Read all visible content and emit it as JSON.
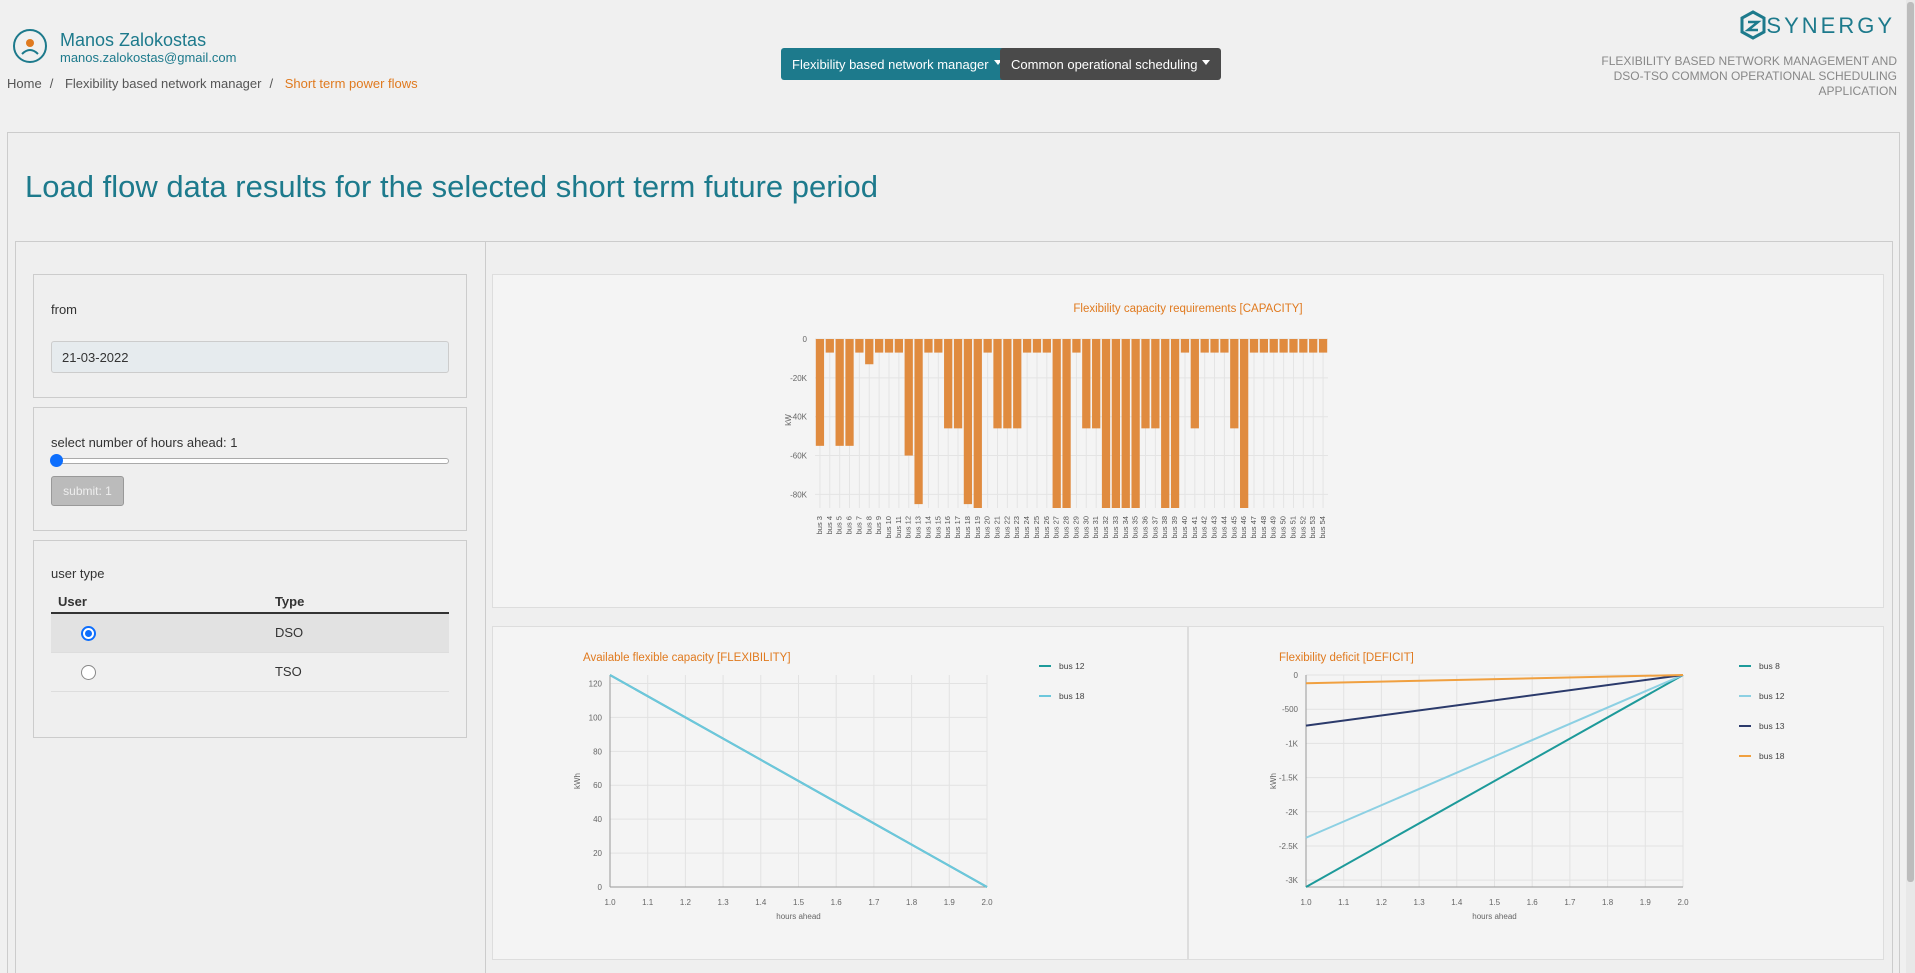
{
  "user": {
    "name": "Manos Zalokostas",
    "email": "manos.zalokostas@gmail.com"
  },
  "breadcrumb": [
    "Home",
    "Flexibility based network manager",
    "Short term power flows"
  ],
  "nav": {
    "flex_manager": "Flexibility based network manager",
    "common_scheduling": "Common operational scheduling"
  },
  "brand": {
    "name": "SYNERGY",
    "subtitle_line1": "FLEXIBILITY BASED NETWORK MANAGEMENT AND",
    "subtitle_line2": "DSO-TSO COMMON OPERATIONAL SCHEDULING",
    "subtitle_line3": "APPLICATION"
  },
  "page": {
    "title": "Load flow data results for the selected short term future period"
  },
  "filters": {
    "from_label": "from",
    "from_value": "21-03-2022",
    "hours_label": "select number of hours ahead: 1",
    "hours_value": 1,
    "submit_label": "submit: 1",
    "user_type_label": "user type",
    "table_headers": [
      "User",
      "Type"
    ],
    "rows": [
      {
        "type": "DSO",
        "selected": true
      },
      {
        "type": "TSO",
        "selected": false
      }
    ]
  },
  "colors": {
    "accent": "#1d7a8c",
    "orange": "#e07a1f",
    "bar": "#e08b3f"
  },
  "chart_data": [
    {
      "type": "bar",
      "title": "Flexibility capacity requirements [CAPACITY]",
      "ylabel": "kW",
      "ylim": [
        -87000,
        0
      ],
      "yticks": [
        "0",
        "-20K",
        "-40K",
        "-60K",
        "-80K"
      ],
      "yticks_values": [
        0,
        -20000,
        -40000,
        -60000,
        -80000
      ],
      "categories": [
        "bus 3",
        "bus 4",
        "bus 5",
        "bus 6",
        "bus 7",
        "bus 8",
        "bus 9",
        "bus 10",
        "bus 11",
        "bus 12",
        "bus 13",
        "bus 14",
        "bus 15",
        "bus 16",
        "bus 17",
        "bus 18",
        "bus 19",
        "bus 20",
        "bus 21",
        "bus 22",
        "bus 23",
        "bus 24",
        "bus 25",
        "bus 26",
        "bus 27",
        "bus 28",
        "bus 29",
        "bus 30",
        "bus 31",
        "bus 32",
        "bus 33",
        "bus 34",
        "bus 35",
        "bus 36",
        "bus 37",
        "bus 38",
        "bus 39",
        "bus 40",
        "bus 41",
        "bus 42",
        "bus 43",
        "bus 44",
        "bus 45",
        "bus 46",
        "bus 47",
        "bus 48",
        "bus 49",
        "bus 50",
        "bus 51",
        "bus 52",
        "bus 53",
        "bus 54"
      ],
      "category_labels": [
        "bus 3",
        "bus 4",
        "bus 5",
        "bus 6",
        "bus 7",
        "bus 8",
        "bus 9",
        "bus 10",
        "bus 11",
        "bus 12",
        "bus 13",
        "bus 14",
        "bus 15",
        "bus 16",
        "bus 17",
        "bus 18",
        "bus 19",
        "bus 20",
        "bus 21",
        "bus 22",
        "bus 23",
        "bus 24",
        "bus 25",
        "bus 26",
        "bus 27",
        "bus 28",
        "bus 29",
        "bus 30",
        "bus 31",
        "bus 32",
        "bus 33",
        "bus 34",
        "bus 35",
        "bus 36",
        "bus 37",
        "bus 38",
        "bus 39",
        "bus 40",
        "bus 41",
        "bus 42",
        "bus 43",
        "bus 44",
        "bus 45",
        "bus 46",
        "bus 47",
        "bus 48",
        "bus 49",
        "bus 50",
        "bus 51",
        "bus 52",
        "bus 53",
        "bus 54"
      ],
      "values": [
        -55000,
        -7000,
        -55000,
        -55000,
        -7000,
        -13000,
        -7000,
        -7000,
        -7000,
        -60000,
        -85000,
        -7000,
        -7000,
        -46000,
        -46000,
        -85000,
        -87000,
        -7000,
        -46000,
        -46000,
        -46000,
        -7000,
        -7000,
        -7000,
        -87000,
        -87000,
        -7000,
        -46000,
        -46000,
        -87000,
        -87000,
        -87000,
        -87000,
        -46000,
        -46000,
        -87000,
        -87000,
        -7000,
        -46000,
        -7000,
        -7000,
        -7000,
        -46000,
        -87000,
        -7000,
        -7000,
        -7000,
        -7000,
        -7000,
        -7000,
        -7000,
        -7000
      ]
    },
    {
      "type": "line",
      "title": "Available flexible capacity [FLEXIBILITY]",
      "xlabel": "hours ahead",
      "ylabel": "kWh",
      "xlim": [
        1.0,
        2.0
      ],
      "ylim": [
        0,
        125
      ],
      "xticks": [
        "1.0",
        "1.1",
        "1.2",
        "1.3",
        "1.4",
        "1.5",
        "1.6",
        "1.7",
        "1.8",
        "1.9",
        "2.0"
      ],
      "yticks": [
        "0",
        "20",
        "40",
        "60",
        "80",
        "100",
        "120"
      ],
      "series": [
        {
          "name": "bus 12",
          "color": "#1d9a9a",
          "x": [
            1.0,
            2.0
          ],
          "y": [
            125,
            0
          ]
        },
        {
          "name": "bus 18",
          "color": "#6cc7dc",
          "x": [
            1.0,
            2.0
          ],
          "y": [
            125,
            0
          ]
        }
      ]
    },
    {
      "type": "line",
      "title": "Flexibility deficit [DEFICIT]",
      "xlabel": "hours ahead",
      "ylabel": "kWh",
      "xlim": [
        1.0,
        2.0
      ],
      "ylim": [
        -3100,
        0
      ],
      "xticks": [
        "1.0",
        "1.1",
        "1.2",
        "1.3",
        "1.4",
        "1.5",
        "1.6",
        "1.7",
        "1.8",
        "1.9",
        "2.0"
      ],
      "yticks": [
        "0",
        "-500",
        "-1K",
        "-1.5K",
        "-2K",
        "-2.5K",
        "-3K"
      ],
      "yticks_values": [
        0,
        -500,
        -1000,
        -1500,
        -2000,
        -2500,
        -3000
      ],
      "series": [
        {
          "name": "bus 8",
          "color": "#1d9a9a",
          "x": [
            1.0,
            2.0
          ],
          "y": [
            -3100,
            0
          ]
        },
        {
          "name": "bus 12",
          "color": "#8cd0e3",
          "x": [
            1.0,
            2.0
          ],
          "y": [
            -2380,
            0
          ]
        },
        {
          "name": "bus 13",
          "color": "#2b3a6b",
          "x": [
            1.0,
            2.0
          ],
          "y": [
            -740,
            0
          ]
        },
        {
          "name": "bus 18",
          "color": "#f0a040",
          "x": [
            1.0,
            2.0
          ],
          "y": [
            -120,
            0
          ]
        }
      ]
    }
  ]
}
